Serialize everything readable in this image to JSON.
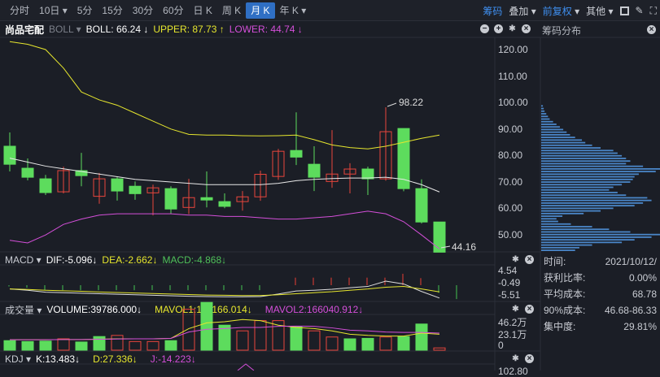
{
  "toolbar": {
    "tabs": [
      "分时",
      "10日 ▾",
      "5分",
      "15分",
      "30分",
      "60分",
      "日 K",
      "周 K",
      "月 K",
      "年 K ▾"
    ],
    "active": "月 K",
    "chips": "筹码",
    "overlay": "叠加 ▾",
    "adjust": "前复权",
    "adjust_arrow": "▾",
    "other": "其他 ▾",
    "grid_icon": "grid-icon",
    "draw_icon": "pen-icon",
    "fullscreen_icon": "expand-icon"
  },
  "main": {
    "stock": "尚品宅配",
    "indicator": "BOLL ▾",
    "boll": "BOLL: 66.24 ↓",
    "upper": "UPPER: 87.73 ↑",
    "lower": "LOWER: 44.74 ↓",
    "high_label": "98.22",
    "low_label": "44.16",
    "axis": [
      "120.00",
      "110.00",
      "100.00",
      "90.00",
      "80.00",
      "70.00",
      "60.00",
      "50.00"
    ],
    "chips_title": "筹码分布"
  },
  "macd": {
    "name": "MACD ▾",
    "dif": "DIF:-5.096↓",
    "dea": "DEA:-2.662↓",
    "macd": "MACD:-4.868↓",
    "axis": [
      "4.54",
      "-0.49",
      "-5.51"
    ]
  },
  "volume": {
    "name": "成交量 ▾",
    "vol": "VOLUME:39786.000↓",
    "mavol1": "MAVOL1:161166.014↓",
    "mavol2": "MAVOL2:166040.912↓",
    "axis": [
      "46.2万",
      "23.1万",
      "0"
    ]
  },
  "kdj": {
    "name": "KDJ ▾",
    "k": "K:13.483↓",
    "d": "D:27.336↓",
    "j": "J:-14.223↓",
    "axis_top": "102.80"
  },
  "chip_info": [
    {
      "label": "时间:",
      "value": "2021/10/12/"
    },
    {
      "label": "获利比率:",
      "value": "0.00%"
    },
    {
      "label": "平均成本:",
      "value": "68.78"
    },
    {
      "label": "90%成本:",
      "value": "46.68-86.33"
    },
    {
      "label": "集中度:",
      "value": "29.81%"
    }
  ],
  "colors": {
    "up": "#e8453c",
    "down": "#5ddc5d",
    "boll": "#e8e8e8",
    "upper": "#e6e62e",
    "lower": "#d44fd9",
    "chip": "#4a86c8"
  },
  "chart_data": {
    "type": "candlestick",
    "ylim": [
      43.5,
      125
    ],
    "candles": [
      [
        83.5,
        76.7,
        88.7,
        74
      ],
      [
        75.2,
        71.8,
        78.9,
        70.6
      ],
      [
        71.2,
        66,
        72.7,
        65.1
      ],
      [
        66.3,
        74.3,
        75.8,
        65.7
      ],
      [
        74.3,
        72.4,
        81,
        68.4
      ],
      [
        64.6,
        71.2,
        73.4,
        61.8
      ],
      [
        71.2,
        66.6,
        72,
        63
      ],
      [
        68.4,
        65.6,
        70.2,
        63.3
      ],
      [
        65.9,
        67.8,
        69,
        57.4
      ],
      [
        67.5,
        59.8,
        68.4,
        57.9
      ],
      [
        60.4,
        64.1,
        71.2,
        57.9
      ],
      [
        64.1,
        63.2,
        74,
        60.4
      ],
      [
        62.6,
        60.8,
        65.7,
        60.1
      ],
      [
        62.6,
        64.4,
        66.6,
        59.2
      ],
      [
        64.4,
        72.9,
        74.3,
        62.9
      ],
      [
        72.1,
        81.6,
        82.5,
        70.8
      ],
      [
        81.9,
        79.4,
        96.3,
        76.4
      ],
      [
        76.7,
        71.8,
        83.5,
        66.6
      ],
      [
        70.2,
        73,
        89.6,
        67.8
      ],
      [
        73,
        74.9,
        77.1,
        65.7
      ],
      [
        74.9,
        71.2,
        75.8,
        65.1
      ],
      [
        71.2,
        89,
        98.22,
        70.5
      ],
      [
        90.2,
        67.5,
        90.2,
        66.5
      ],
      [
        67.5,
        54.9,
        71,
        54.3
      ],
      [
        54.9,
        43.5,
        54.9,
        44.16
      ]
    ],
    "upper": [
      123,
      122,
      120,
      113,
      104,
      101,
      99,
      96,
      93,
      90,
      88,
      87.7,
      87.7,
      87.5,
      87.4,
      87.5,
      87.7,
      86,
      84,
      83,
      82.5,
      83.5,
      85,
      86.5,
      87.73
    ],
    "mid": [
      79,
      77.5,
      76,
      75,
      74,
      73,
      72,
      71,
      70.5,
      70,
      69.5,
      69,
      69,
      69,
      69,
      69.5,
      70.5,
      71,
      71.3,
      71.5,
      71.5,
      71.8,
      71,
      69,
      66.24
    ],
    "lower": [
      48,
      47,
      50,
      54,
      56,
      57.5,
      58,
      58,
      58,
      58,
      57.5,
      57.5,
      57,
      57,
      56.5,
      56,
      56,
      56.5,
      57,
      58,
      59,
      58,
      55,
      50,
      44.74
    ],
    "volume": [
      0.42,
      0.38,
      0.4,
      0.5,
      0.36,
      0.6,
      0.65,
      0.38,
      0.38,
      0.42,
      1.8,
      2.1,
      1.1,
      0.85,
      1.3,
      1.3,
      1.05,
      0.85,
      0.58,
      0.5,
      0.52,
      0.58,
      0.6,
      1.15,
      0.1
    ],
    "mavol1": [
      0.46,
      0.46,
      0.46,
      0.47,
      0.47,
      0.48,
      0.5,
      0.5,
      0.5,
      0.52,
      0.95,
      1.2,
      1.25,
      1.35,
      1.3,
      1.1,
      1.0,
      0.95,
      0.85,
      0.7,
      0.65,
      0.62,
      0.62,
      0.75,
      0.7
    ],
    "mavol2": [
      0.46,
      0.46,
      0.46,
      0.47,
      0.47,
      0.48,
      0.49,
      0.5,
      0.5,
      0.52,
      0.8,
      0.92,
      0.95,
      1.0,
      1.0,
      1.05,
      1.06,
      1.05,
      0.98,
      0.88,
      0.85,
      0.8,
      0.78,
      0.78,
      0.75
    ],
    "macd_hist": [
      -0.5,
      -1,
      -2,
      -2,
      -2,
      -2,
      -2,
      -2,
      -2,
      -2,
      -2,
      -2,
      -2,
      -2,
      -2,
      0,
      3,
      3,
      3,
      3,
      3,
      3,
      4.54,
      2.8,
      -3,
      -5.51
    ],
    "dif": [
      -1.5,
      -2,
      -2.8,
      -3,
      -3.2,
      -3.4,
      -3.6,
      -3.8,
      -4,
      -4.2,
      -4.4,
      -4.5,
      -4.6,
      -4.6,
      -4.5,
      -3.5,
      -2.3,
      -2,
      -1.6,
      -1,
      -0.5,
      1.6,
      0.5,
      -2.5,
      -5.096
    ],
    "dea": [
      -1.5,
      -1.7,
      -2,
      -2.2,
      -2.4,
      -2.7,
      -2.9,
      -3.1,
      -3.3,
      -3.5,
      -3.7,
      -3.9,
      -4,
      -4.1,
      -4.1,
      -3.8,
      -3.4,
      -3,
      -2.6,
      -2,
      -1.5,
      -0.8,
      -0.5,
      -1.5,
      -2.662
    ],
    "chip_profile": [
      2,
      3,
      4,
      6,
      8,
      10,
      14,
      18,
      22,
      26,
      30,
      34,
      40,
      48,
      52,
      60,
      70,
      85,
      90,
      95,
      100,
      105,
      100,
      120,
      140,
      135,
      115,
      110,
      108,
      105,
      95,
      85,
      80,
      90,
      100,
      125,
      130,
      120,
      110,
      85,
      70,
      50,
      25,
      18,
      20,
      35,
      60,
      80,
      105,
      140,
      130,
      110,
      95,
      60,
      45,
      40
    ]
  }
}
